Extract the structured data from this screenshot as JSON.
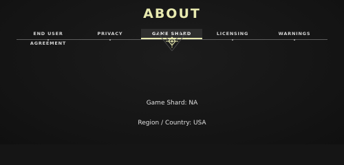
{
  "colors": {
    "accent": "#e8eab0",
    "background": "#151515"
  },
  "page": {
    "title": "ABOUT"
  },
  "tabs": [
    {
      "label": "END USER AGREEMENT",
      "active": false
    },
    {
      "label": "PRIVACY",
      "active": false
    },
    {
      "label": "GAME SHARD",
      "active": true
    },
    {
      "label": "LICENSING",
      "active": false
    },
    {
      "label": "WARNINGS",
      "active": false
    }
  ],
  "content": {
    "game_shard": "Game Shard: NA",
    "region": "Region / Country: USA"
  },
  "icons": {
    "emblem": "diamond-emblem-icon"
  }
}
